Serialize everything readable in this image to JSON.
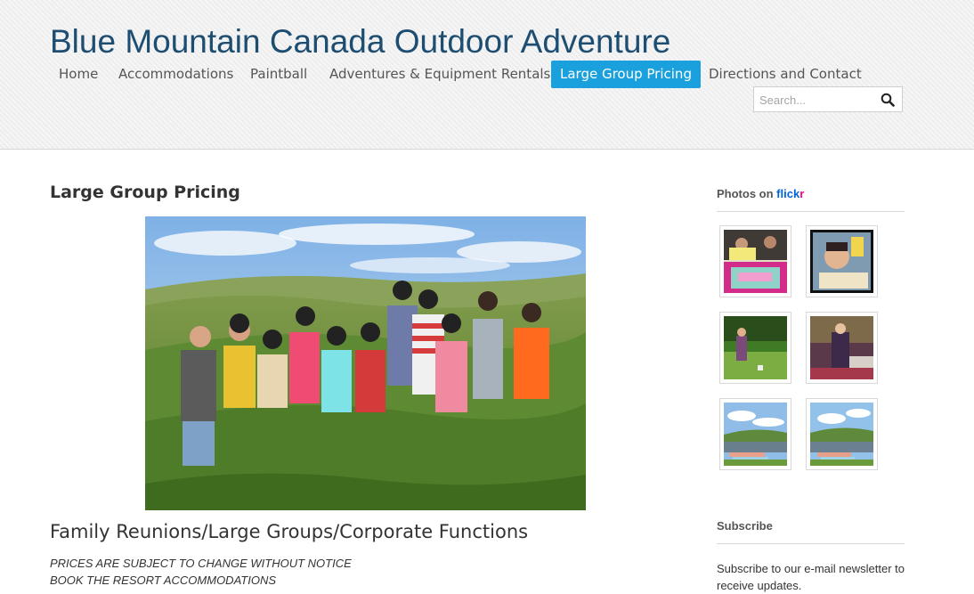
{
  "site": {
    "title": "Blue Mountain Canada Outdoor Adventure"
  },
  "nav": {
    "items": [
      {
        "label": "Home"
      },
      {
        "label": "Accommodations"
      },
      {
        "label": "Paintball"
      },
      {
        "label": "Adventures & Equipment Rentals"
      },
      {
        "label": "Large Group Pricing",
        "active": true
      },
      {
        "label": "Directions and Contact"
      }
    ]
  },
  "search": {
    "placeholder": "Search...",
    "icon": "magnifier-icon"
  },
  "main": {
    "page_title": "Large Group Pricing",
    "section_title": "Family Reunions/Large Groups/Corporate Functions",
    "notes": [
      "PRICES ARE SUBJECT TO CHANGE WITHOUT NOTICE",
      "BOOK THE RESORT ACCOMMODATIONS"
    ]
  },
  "sidebar": {
    "photos_title": "Photos on ",
    "flickr_part1": "flick",
    "flickr_part2": "r",
    "subscribe_title": "Subscribe",
    "subscribe_text": "Subscribe to our e-mail newsletter to receive updates."
  },
  "colors": {
    "accent": "#1aa0dc",
    "title": "#1d4e72",
    "flickr_blue": "#0063dc",
    "flickr_pink": "#ff0084"
  }
}
